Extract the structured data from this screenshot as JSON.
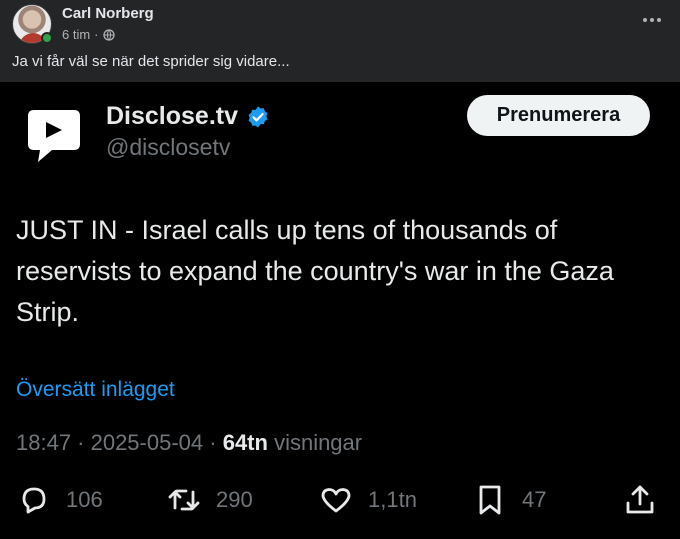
{
  "post": {
    "author": "Carl Norberg",
    "time": "6 tim",
    "privacy_icon": "globe-icon",
    "separator": "·",
    "caption": "Ja vi får väl se när det sprider sig vidare...",
    "more_icon": "more-options-icon"
  },
  "tweet": {
    "display_name": "Disclose.tv",
    "handle": "@disclosetv",
    "verified_color": "#1d9bf0",
    "subscribe_label": "Prenumerera",
    "text": "JUST IN - Israel calls up tens of thousands of reservists to expand the country's war in the Gaza Strip.",
    "translate_label": "Översätt inlägget",
    "timestamp": "18:47 · 2025-05-04 · ",
    "views_count": "64tn",
    "views_label": " visningar",
    "actions": {
      "replies": "106",
      "reposts": "290",
      "likes": "1,1tn",
      "bookmarks": "47"
    }
  },
  "colors": {
    "fb_background": "#242526",
    "tweet_background": "#000000",
    "link_blue": "#1d9bf0",
    "online_green": "#31a24c"
  }
}
